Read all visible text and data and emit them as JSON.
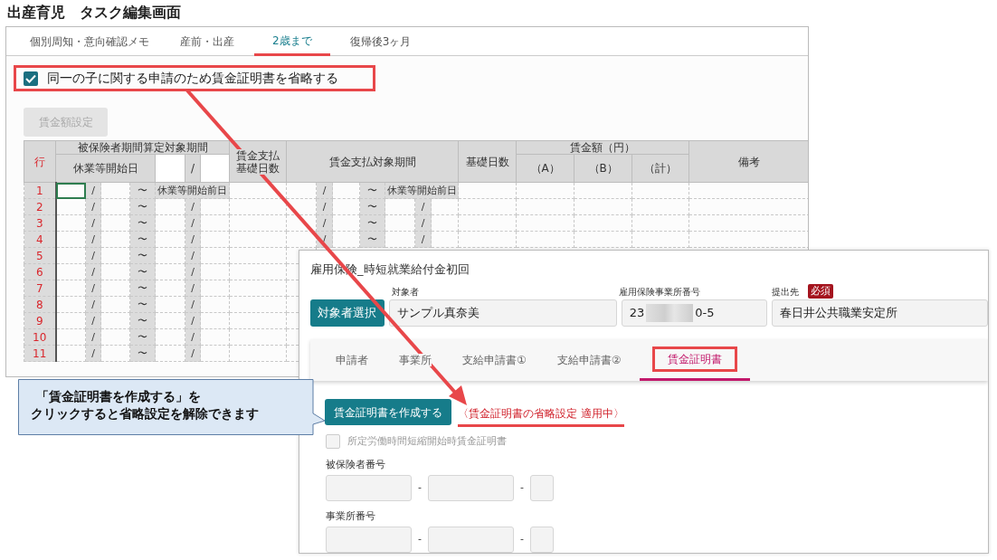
{
  "page_title": "出産育児　タスク編集画面",
  "task_tabs": [
    {
      "label": "個別周知・意向確認メモ",
      "selected": false
    },
    {
      "label": "産前・出産",
      "selected": false
    },
    {
      "label": "2歳まで",
      "selected": true
    },
    {
      "label": "復帰後3ヶ月",
      "selected": false
    }
  ],
  "omit_checkbox": {
    "label": "同一の子に関する申請のため賃金証明書を省略する",
    "checked": true
  },
  "wage_setting_button": {
    "label": "賃金額設定",
    "disabled": true
  },
  "wage_table": {
    "row_header": "行",
    "insured_period_header": "被保険者期間算定対象期間",
    "start_label": "休業等開始日",
    "start_sep": "/",
    "base_days_header": "賃金支払基礎日数",
    "pay_period_header": "賃金支払対象期間",
    "days_header": "基礎日数",
    "amount_header": "賃金額（円）",
    "amount_columns": [
      "（A）",
      "（B）",
      "（計）"
    ],
    "remarks_header": "備考",
    "rows": [
      {
        "number": "1",
        "selected": true,
        "period": {
          "sep": "/",
          "tilde": "〜",
          "end": "休業等開始前日"
        },
        "pay_period": {
          "sep": "/",
          "tilde": "〜",
          "end": "休業等開始前日"
        }
      },
      {
        "number": "2",
        "selected": false,
        "period": {
          "sep": "/",
          "tilde": "〜",
          "end_sep": "/"
        },
        "pay_period": {
          "sep": "/",
          "tilde": "〜",
          "end_sep": "/"
        }
      },
      {
        "number": "3",
        "selected": false,
        "period": {
          "sep": "/",
          "tilde": "〜",
          "end_sep": "/"
        },
        "pay_period": {
          "sep": "/",
          "tilde": "〜",
          "end_sep": "/"
        }
      },
      {
        "number": "4",
        "selected": false,
        "period": {
          "sep": "/",
          "tilde": "〜",
          "end_sep": "/"
        },
        "pay_period": {
          "sep": "/",
          "tilde": "〜",
          "end_sep": "/"
        }
      },
      {
        "number": "5",
        "selected": false,
        "period": {
          "sep": "/",
          "tilde": "〜",
          "end_sep": "/"
        }
      },
      {
        "number": "6",
        "selected": false,
        "period": {
          "sep": "/",
          "tilde": "〜",
          "end_sep": "/"
        }
      },
      {
        "number": "7",
        "selected": false,
        "period": {
          "sep": "/",
          "tilde": "〜",
          "end_sep": "/"
        }
      },
      {
        "number": "8",
        "selected": false,
        "period": {
          "sep": "/",
          "tilde": "〜",
          "end_sep": "/"
        }
      },
      {
        "number": "9",
        "selected": false,
        "period": {
          "sep": "/",
          "tilde": "〜",
          "end_sep": "/"
        }
      },
      {
        "number": "10",
        "selected": false,
        "period": {
          "sep": "/",
          "tilde": "〜",
          "end_sep": "/"
        }
      },
      {
        "number": "11",
        "selected": false,
        "period": {
          "sep": "/",
          "tilde": "〜",
          "end_sep": "/"
        }
      }
    ]
  },
  "form_panel": {
    "title": "雇用保険_時短就業給付金初回",
    "select_button": "対象者選択",
    "fields": [
      {
        "label": "対象者",
        "value": "サンプル真奈美"
      },
      {
        "label": "雇用保険事業所番号",
        "value_start": "23",
        "value_end": "0-5"
      },
      {
        "label": "提出先",
        "badge": "必須",
        "value": "春日井公共職業安定所"
      }
    ],
    "tabs": [
      {
        "label": "申請者",
        "selected": false
      },
      {
        "label": "事業所",
        "selected": false
      },
      {
        "label": "支給申請書①",
        "selected": false
      },
      {
        "label": "支給申請書②",
        "selected": false
      },
      {
        "label": "賃金証明書",
        "selected": true
      }
    ],
    "create_button": "賃金証明書を作成する",
    "status_text": "〈賃金証明書の省略設定 適用中〉",
    "reduced_hours_checkbox": {
      "label": "所定労働時間短縮開始時賃金証明書",
      "checked": false,
      "disabled": true
    },
    "number_groups": [
      {
        "label": "被保険者番号",
        "separators": [
          "-",
          "-"
        ]
      },
      {
        "label": "事業所番号",
        "separators": [
          "-",
          "-"
        ]
      }
    ]
  },
  "callout_lines": [
    "「賃金証明書を作成する」を",
    "クリックすると省略設定を解除できます"
  ]
}
